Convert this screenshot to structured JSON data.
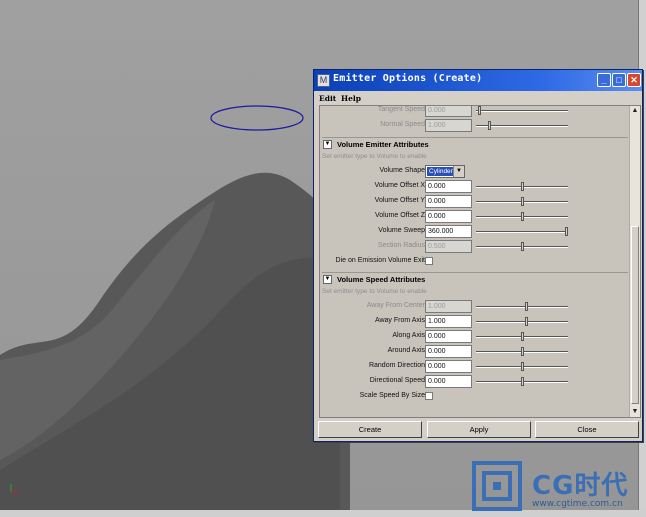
{
  "dialog": {
    "title": "Emitter Options (Create)",
    "menu": [
      "Edit",
      "Help"
    ],
    "top_rows": [
      {
        "label": "Tangent Speed",
        "value": "0.000",
        "enabled": false,
        "slider": 0.02
      },
      {
        "label": "Normal Speed",
        "value": "1.000",
        "enabled": false,
        "slider": 0.14
      }
    ],
    "volume_emitter": {
      "title": "Volume Emitter Attributes",
      "hint": "Set emitter type to Volume to enable",
      "shape_label": "Volume Shape",
      "shape_value": "Cylinder",
      "rows": [
        {
          "label": "Volume Offset X",
          "value": "0.000",
          "enabled": true,
          "slider": 0.5
        },
        {
          "label": "Volume Offset Y",
          "value": "0.000",
          "enabled": true,
          "slider": 0.5
        },
        {
          "label": "Volume Offset Z",
          "value": "0.000",
          "enabled": true,
          "slider": 0.5
        },
        {
          "label": "Volume Sweep",
          "value": "360.000",
          "enabled": true,
          "slider": 1.0
        },
        {
          "label": "Section Radius",
          "value": "0.500",
          "enabled": false,
          "slider": 0.5
        }
      ],
      "die_label": "Die on Emission Volume Exit"
    },
    "volume_speed": {
      "title": "Volume Speed Attributes",
      "hint": "Set emitter type to Volume to enable",
      "rows": [
        {
          "label": "Away From Center",
          "value": "1.000",
          "enabled": false,
          "slider": 0.55
        },
        {
          "label": "Away From Axis",
          "value": "1.000",
          "enabled": true,
          "slider": 0.55
        },
        {
          "label": "Along Axis",
          "value": "0.000",
          "enabled": true,
          "slider": 0.5
        },
        {
          "label": "Around Axis",
          "value": "0.000",
          "enabled": true,
          "slider": 0.5
        },
        {
          "label": "Random Direction",
          "value": "0.000",
          "enabled": true,
          "slider": 0.5
        },
        {
          "label": "Directional Speed",
          "value": "0.000",
          "enabled": true,
          "slider": 0.5
        }
      ],
      "scale_label": "Scale Speed By Size"
    },
    "buttons": {
      "create": "Create",
      "apply": "Apply",
      "close": "Close"
    }
  },
  "watermark": {
    "text": "CG时代",
    "url": "www.cgtime.com.cn"
  },
  "axis": {
    "y": "Y",
    "x": "X"
  }
}
